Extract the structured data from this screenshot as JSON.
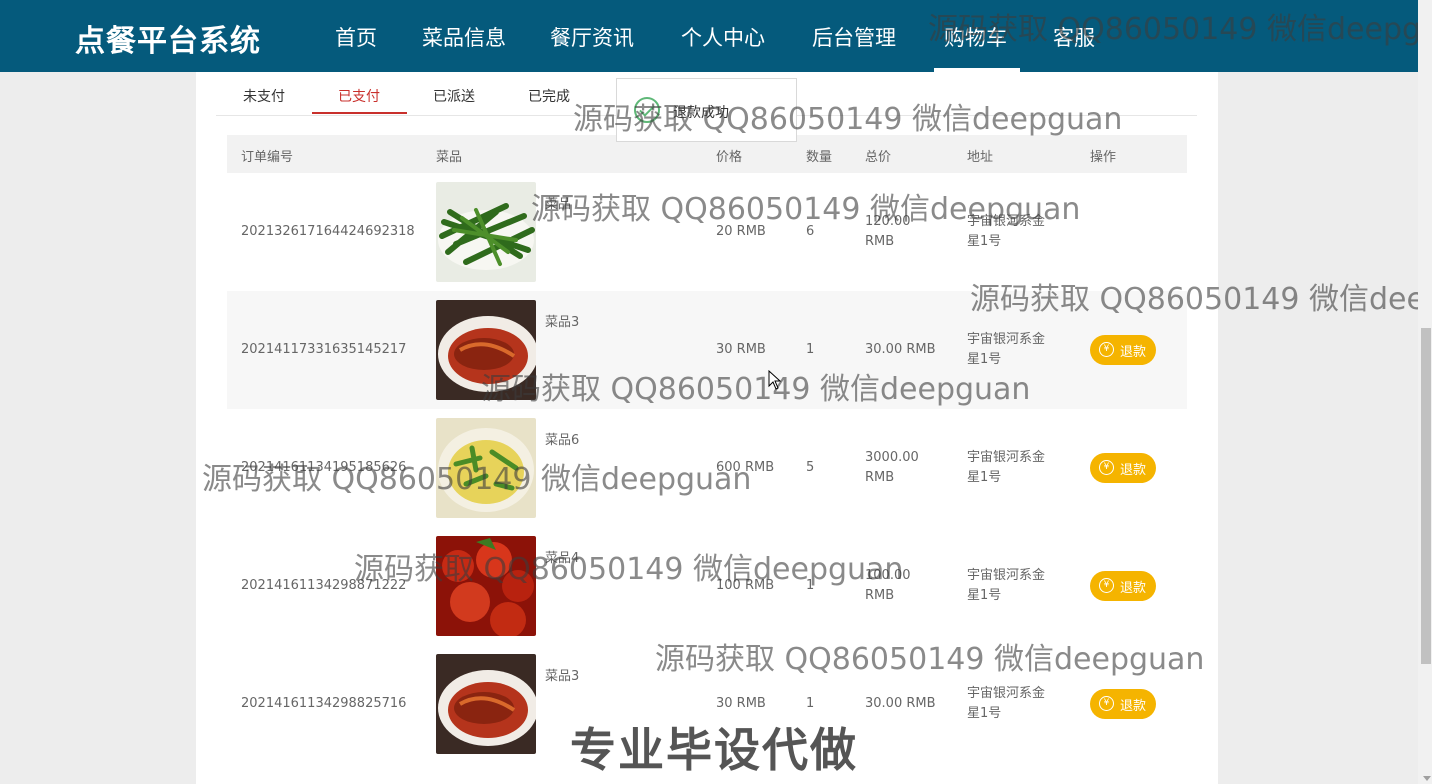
{
  "brand": "点餐平台系统",
  "nav": [
    {
      "label": "首页"
    },
    {
      "label": "菜品信息"
    },
    {
      "label": "餐厅资讯"
    },
    {
      "label": "个人中心"
    },
    {
      "label": "后台管理"
    },
    {
      "label": "购物车",
      "active": true
    },
    {
      "label": "客服"
    }
  ],
  "tabs": [
    {
      "label": "未支付"
    },
    {
      "label": "已支付",
      "active": true
    },
    {
      "label": "已派送"
    },
    {
      "label": "已完成"
    }
  ],
  "toast": {
    "text": "退款成功",
    "icon": "check-circle-icon"
  },
  "table": {
    "headers": [
      "订单编号",
      "菜品",
      "价格",
      "数量",
      "总价",
      "地址",
      "操作"
    ],
    "rows": [
      {
        "order_no": "202132617164424692318",
        "dish": "菜品",
        "price": "20 RMB",
        "qty": "6",
        "total": "120.00 RMB",
        "address": "宇宙银河系金星1号",
        "action": ""
      },
      {
        "order_no": "20214117331635145217",
        "dish": "菜品3",
        "price": "30 RMB",
        "qty": "1",
        "total": "30.00 RMB",
        "address": "宇宙银河系金星1号",
        "action": "退款"
      },
      {
        "order_no": "20214161134195185626",
        "dish": "菜品6",
        "price": "600 RMB",
        "qty": "5",
        "total": "3000.00 RMB",
        "address": "宇宙银河系金星1号",
        "action": "退款"
      },
      {
        "order_no": "20214161134298871222",
        "dish": "菜品4",
        "price": "100 RMB",
        "qty": "1",
        "total": "100.00 RMB",
        "address": "宇宙银河系金星1号",
        "action": "退款"
      },
      {
        "order_no": "20214161134298825716",
        "dish": "菜品3",
        "price": "30 RMB",
        "qty": "1",
        "total": "30.00 RMB",
        "address": "宇宙银河系金星1号",
        "action": "退款"
      }
    ]
  },
  "watermark": "源码获取 QQ86050149 微信deepguan",
  "big_watermark": "专业毕设代做",
  "colors": {
    "nav_bg": "#055a7c",
    "accent_tab": "#c9302c",
    "refund_btn": "#f5b400",
    "toast_icon": "#5fb878"
  }
}
